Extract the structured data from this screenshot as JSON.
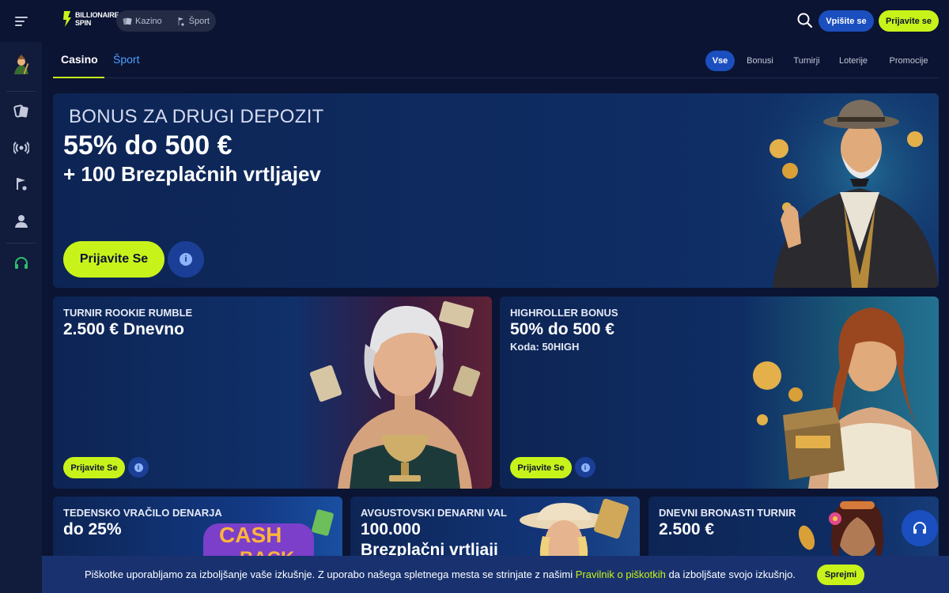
{
  "header": {
    "logo_line1": "BILLIONAIRE",
    "logo_line2": "SPIN",
    "products": [
      {
        "label": "Kazino",
        "icon": "cards-icon"
      },
      {
        "label": "Šport",
        "icon": "sport-icon"
      }
    ],
    "login_label": "Vpišite se",
    "register_label": "Prijavite se"
  },
  "sidebar": {
    "items": [
      {
        "icon": "character-icon"
      },
      {
        "icon": "cards-icon"
      },
      {
        "icon": "live-broadcast-icon"
      },
      {
        "icon": "sport-flag-icon"
      },
      {
        "icon": "profile-icon"
      },
      {
        "icon": "headset-icon"
      }
    ]
  },
  "subnav": {
    "tabs": [
      "Casino",
      "Šport"
    ],
    "filters": [
      "Vse",
      "Bonusi",
      "Turnirji",
      "Loterije",
      "Promocije"
    ]
  },
  "hero": {
    "kicker": "BONUS ZA DRUGI DEPOZIT",
    "title": "55% do 500 €",
    "subtitle": "+ 100 Brezplačnih vrtljajev",
    "cta": "Prijavite Se",
    "info": "i"
  },
  "promos": [
    {
      "kicker": "TURNIR ROOKIE RUMBLE",
      "title": "2.500 € Dnevno",
      "code": "",
      "cta": "Prijavite Se",
      "info": "i"
    },
    {
      "kicker": "HIGHROLLER BONUS",
      "title": "50% do 500 €",
      "code": "Koda: 50HIGH",
      "cta": "Prijavite Se",
      "info": "i"
    }
  ],
  "small_promos": [
    {
      "kicker": "TEDENSKO VRAČILO DENARJA",
      "title": "do 25%",
      "art_text1": "CASH",
      "art_text2": "BACK"
    },
    {
      "kicker": "AVGUSTOVSKI DENARNI VAL",
      "title": "100.000",
      "title2": "Brezplačni vrtljaji"
    },
    {
      "kicker": "DNEVNI BRONASTI TURNIR",
      "title": "2.500 €"
    }
  ],
  "cookie": {
    "text_before": "Piškotke uporabljamo za izboljšanje vaše izkušnje. Z uporabo našega spletnega mesta se strinjate z našimi ",
    "link": "Pravilnik o piškotkih",
    "text_after": " da izboljšate svojo izkušnjo.",
    "accept": "Sprejmi"
  },
  "colors": {
    "background": "#0b1433",
    "accent_green": "#c8f31a",
    "accent_blue": "#1b4fbf",
    "card": "#0e2a5e"
  }
}
